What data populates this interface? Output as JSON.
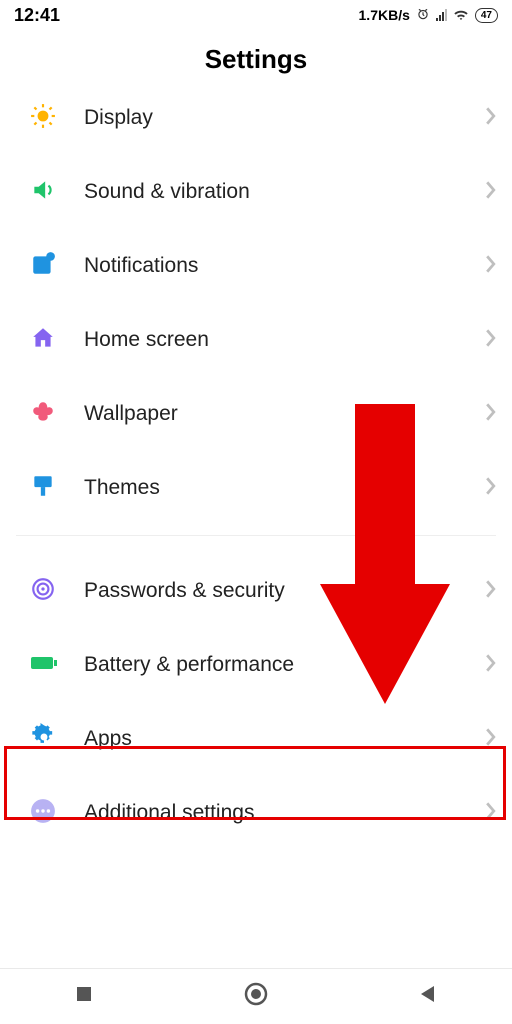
{
  "status": {
    "time": "12:41",
    "net_speed": "1.7KB/s",
    "battery": "47"
  },
  "title": "Settings",
  "group1": [
    {
      "id": "display",
      "label": "Display"
    },
    {
      "id": "sound",
      "label": "Sound & vibration"
    },
    {
      "id": "notifications",
      "label": "Notifications"
    },
    {
      "id": "home",
      "label": "Home screen"
    },
    {
      "id": "wallpaper",
      "label": "Wallpaper"
    },
    {
      "id": "themes",
      "label": "Themes"
    }
  ],
  "group2": [
    {
      "id": "passwords",
      "label": "Passwords & security"
    },
    {
      "id": "battery",
      "label": "Battery & performance"
    },
    {
      "id": "apps",
      "label": "Apps"
    },
    {
      "id": "additional",
      "label": "Additional settings"
    }
  ],
  "annotation": {
    "arrow_target": "apps",
    "highlight_target": "apps",
    "arrow_color": "#e50000"
  }
}
